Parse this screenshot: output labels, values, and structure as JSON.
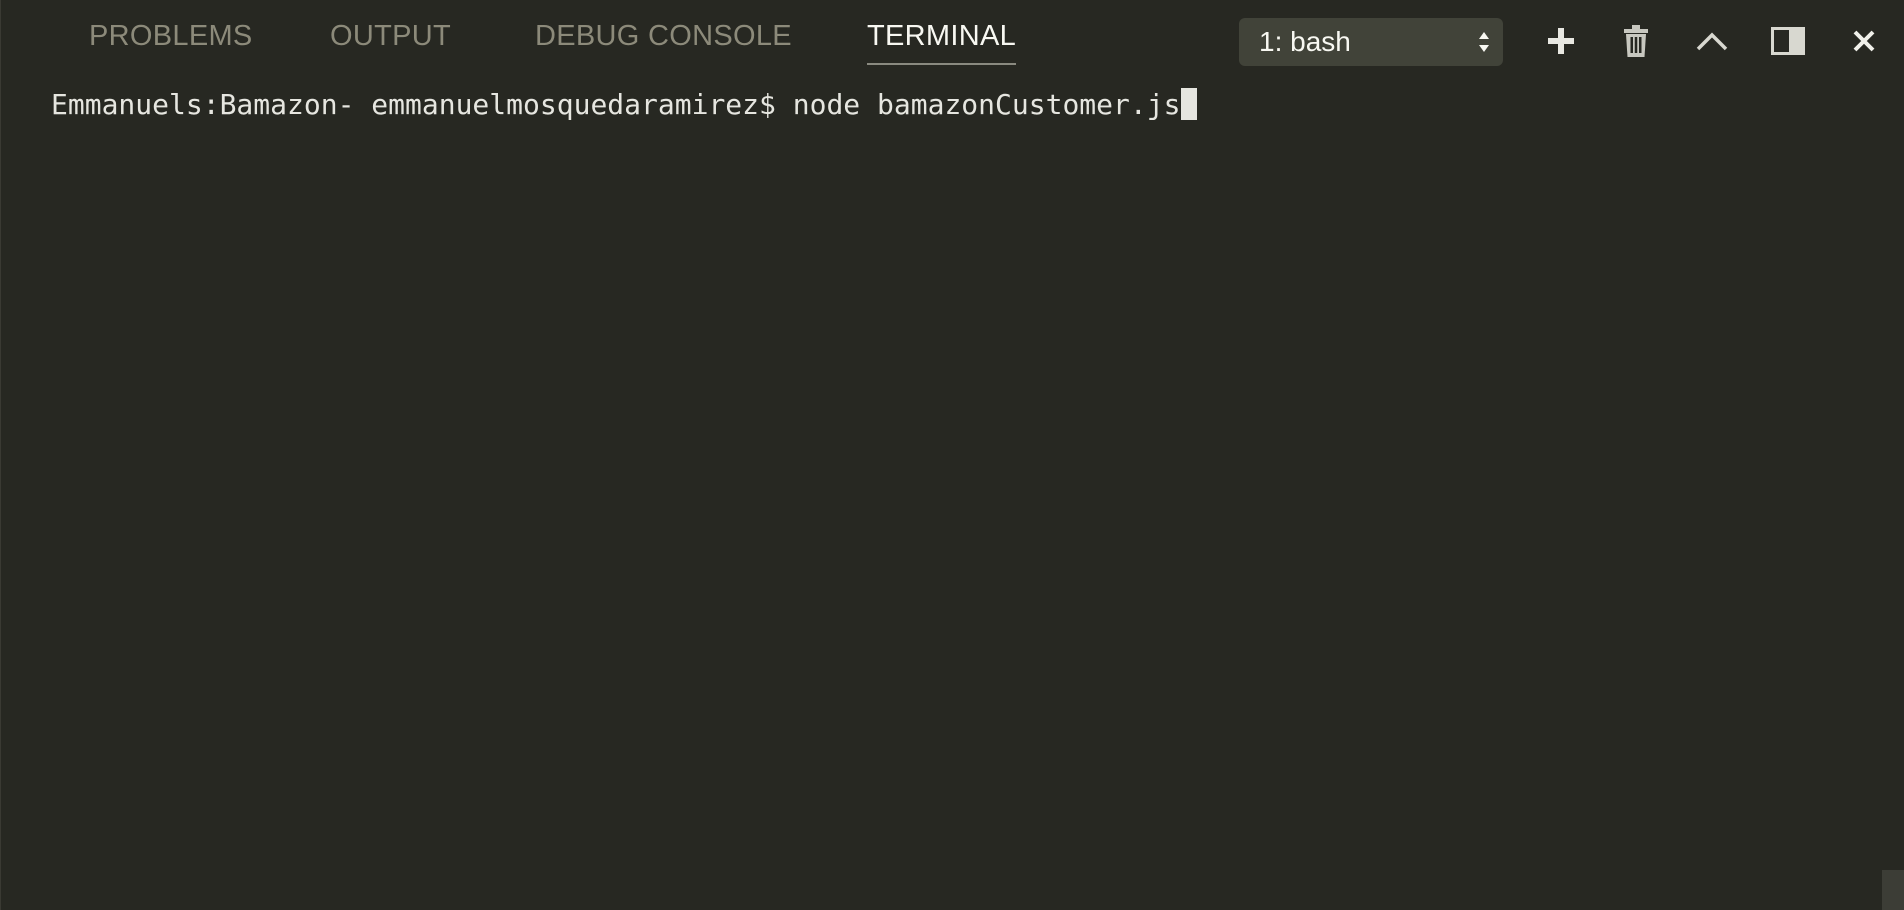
{
  "tabs": [
    {
      "label": "PROBLEMS",
      "active": false
    },
    {
      "label": "OUTPUT",
      "active": false
    },
    {
      "label": "DEBUG CONSOLE",
      "active": false
    },
    {
      "label": "TERMINAL",
      "active": true
    }
  ],
  "terminal_select": {
    "value": "1: bash"
  },
  "toolbar": {
    "icons": [
      "plus-icon",
      "trash-icon",
      "chevron-up-icon",
      "split-panel-icon",
      "close-icon"
    ]
  },
  "terminal": {
    "prompt": "Emmanuels:Bamazon- emmanuelmosquedaramirez$",
    "command": "node bamazonCustomer.js"
  },
  "colors": {
    "background": "#272822",
    "tab_inactive": "#8c8a7a",
    "tab_active": "#f8f8f2",
    "select_bg": "#414339",
    "text": "#e6e6e0"
  }
}
